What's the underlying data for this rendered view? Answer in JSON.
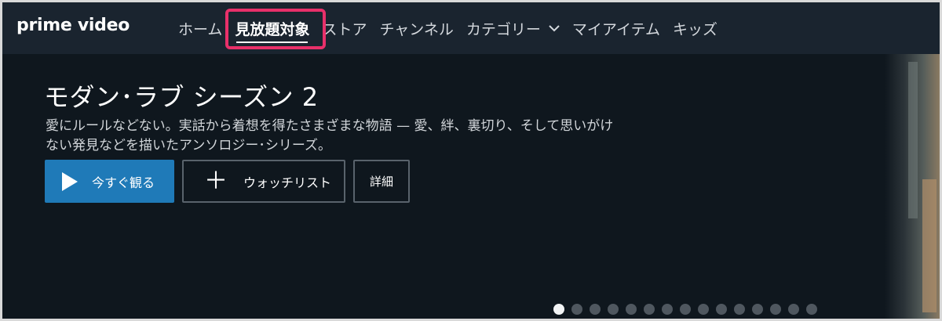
{
  "app": {
    "logo_text": "prime video"
  },
  "nav": {
    "items": [
      {
        "label": "ホーム",
        "active": false
      },
      {
        "label": "見放題対象",
        "active": true
      },
      {
        "label": "ストア",
        "active": false
      },
      {
        "label": "チャンネル",
        "active": false
      },
      {
        "label": "カテゴリー",
        "active": false,
        "has_dropdown": true
      },
      {
        "label": "マイアイテム",
        "active": false
      },
      {
        "label": "キッズ",
        "active": false
      }
    ],
    "highlight_color": "#e8306a"
  },
  "hero": {
    "title": "モダン･ラブ シーズン 2",
    "description_line1": "愛にルールなどない。実話から着想を得たさまざまな物語 — 愛、絆、裏切り、そして思いがけ",
    "description_line2": "ない発見などを描いたアンソロジー･シリーズ。",
    "play_label": "今すぐ観る",
    "watchlist_label": "ウォッチリスト",
    "details_label": "詳細",
    "accent_color": "#1f7ab8"
  },
  "carousel": {
    "total": 15,
    "active_index": 0
  }
}
